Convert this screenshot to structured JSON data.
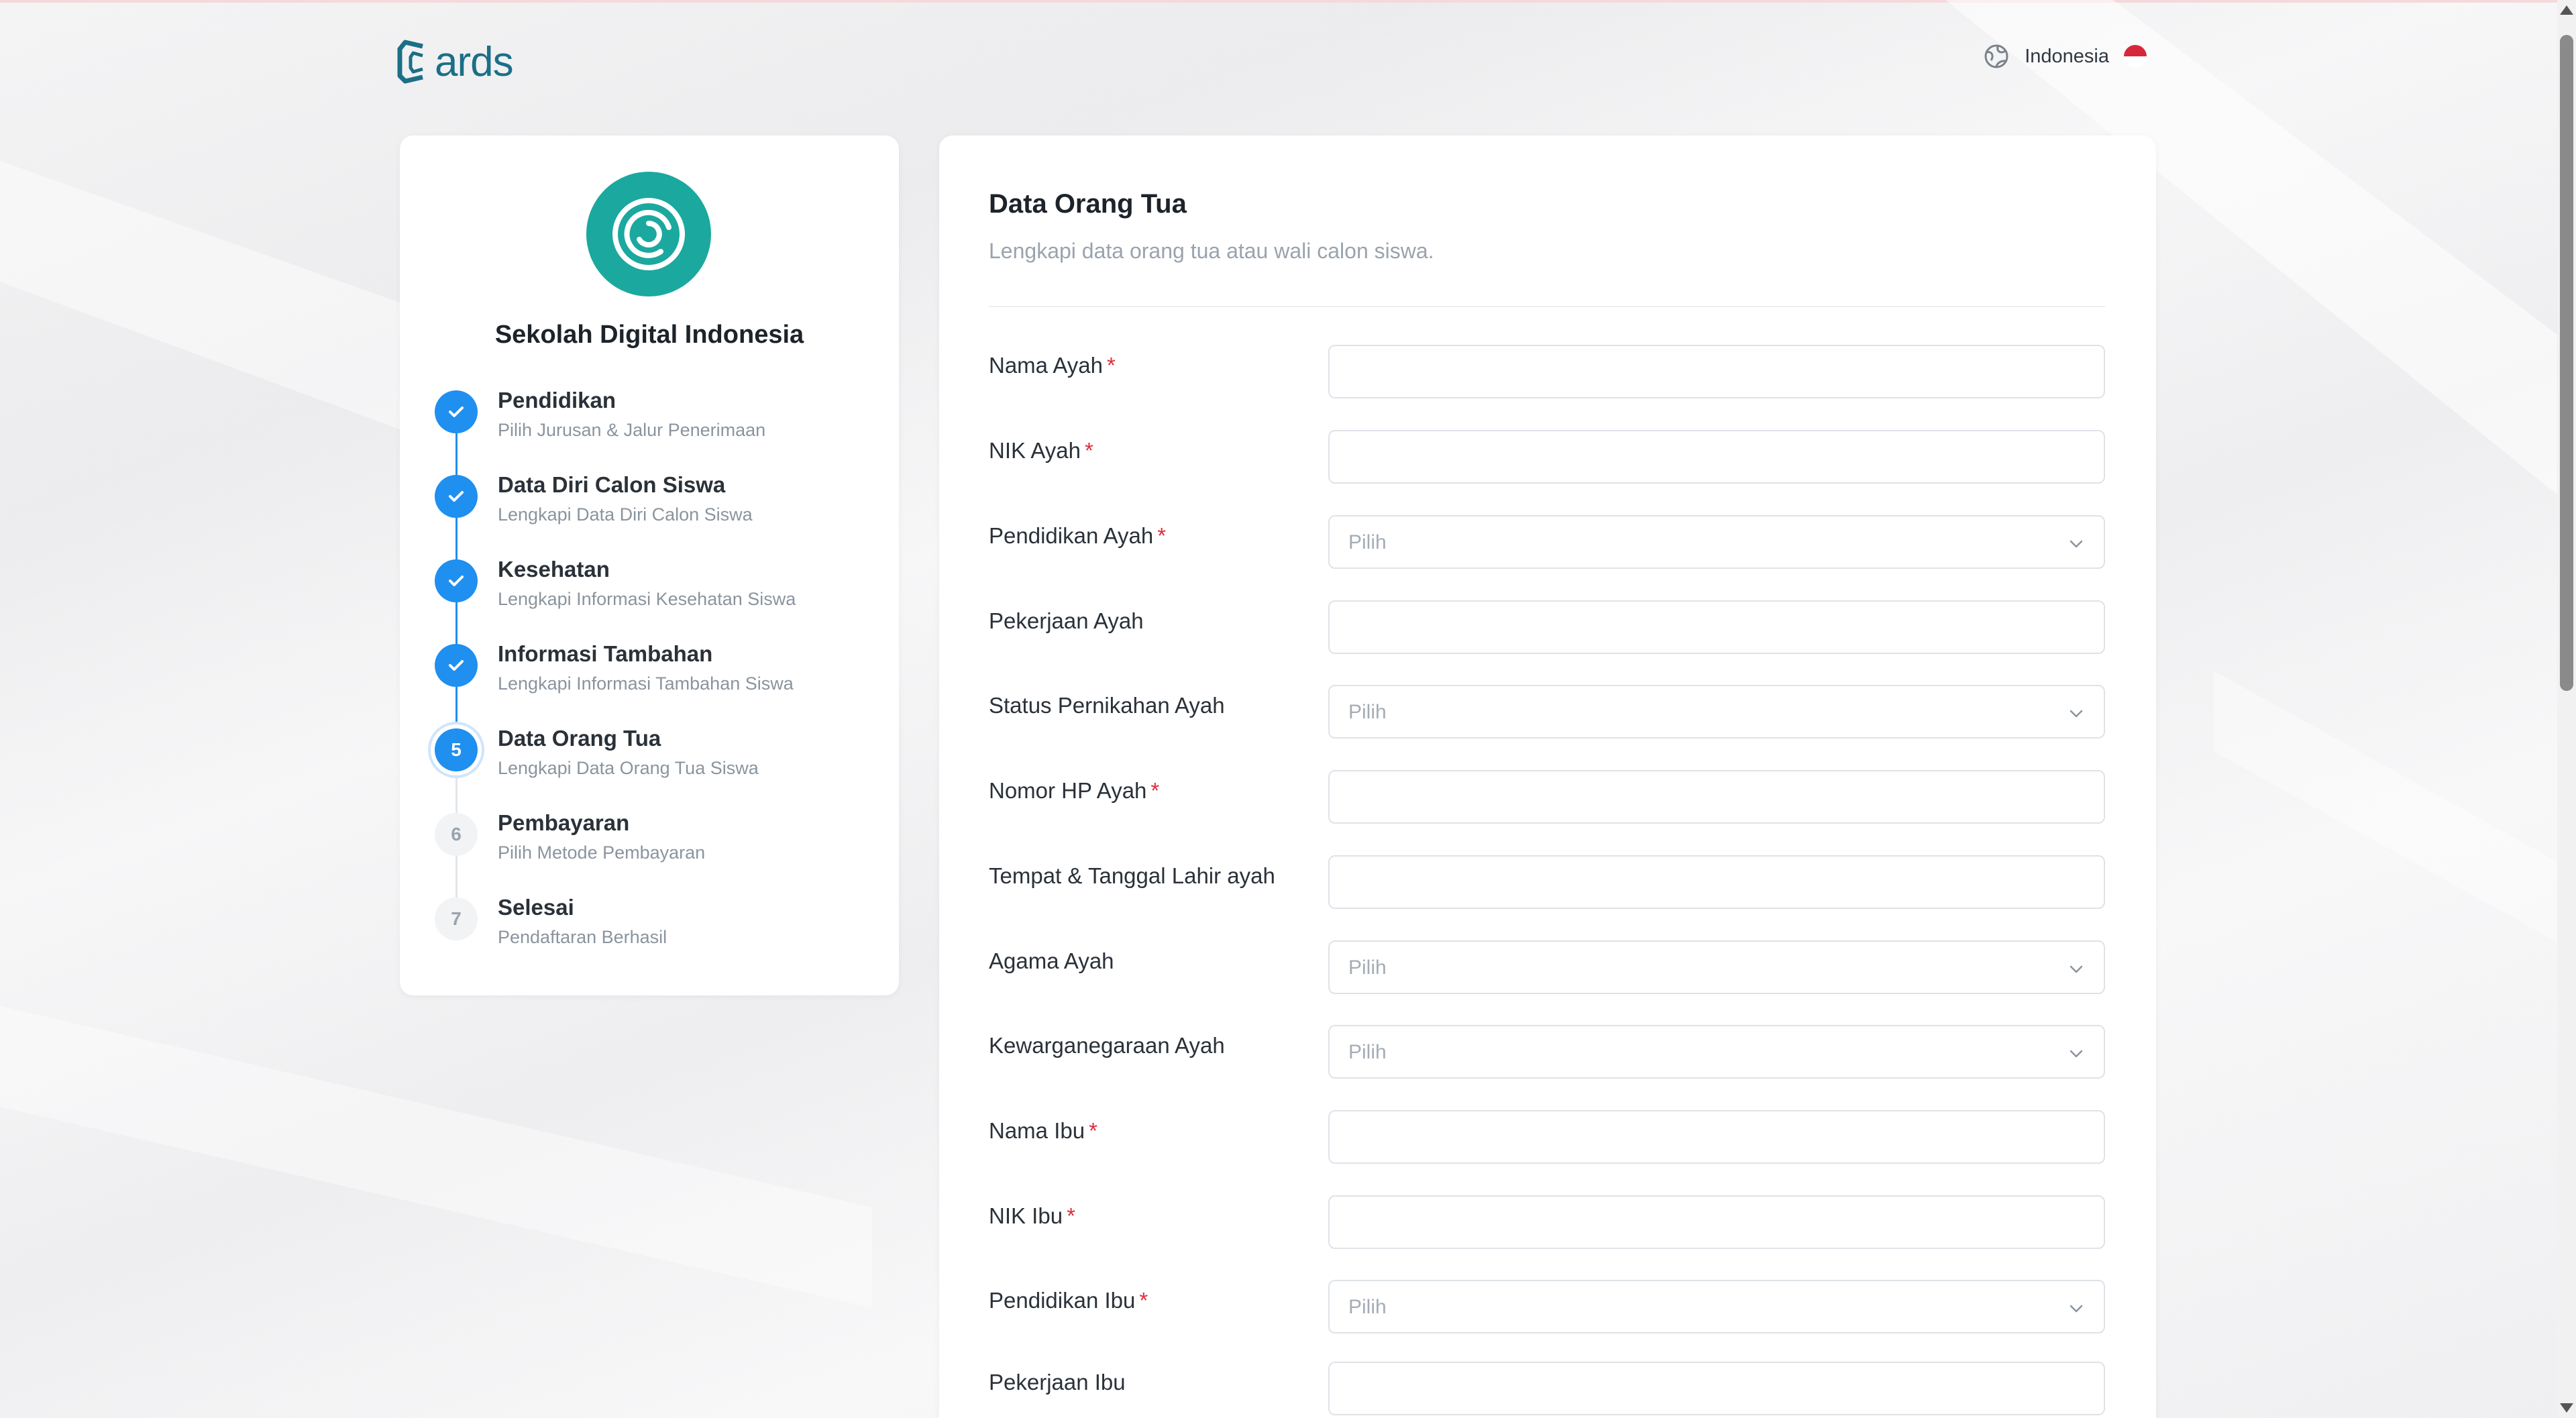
{
  "header": {
    "logo_text": "ards",
    "language": "Indonesia"
  },
  "colors": {
    "accent": "#1f8ff0",
    "school_logo": "#1ba89f",
    "required": "#e02c3c",
    "brand": "#1b6f86"
  },
  "sidebar": {
    "school_name": "Sekolah Digital Indonesia",
    "steps": [
      {
        "number": "1",
        "title": "Pendidikan",
        "subtitle": "Pilih Jurusan & Jalur Penerimaan",
        "status": "done"
      },
      {
        "number": "2",
        "title": "Data Diri Calon Siswa",
        "subtitle": "Lengkapi Data Diri Calon Siswa",
        "status": "done"
      },
      {
        "number": "3",
        "title": "Kesehatan",
        "subtitle": "Lengkapi Informasi Kesehatan Siswa",
        "status": "done"
      },
      {
        "number": "4",
        "title": "Informasi Tambahan",
        "subtitle": "Lengkapi Informasi Tambahan Siswa",
        "status": "done"
      },
      {
        "number": "5",
        "title": "Data Orang Tua",
        "subtitle": "Lengkapi Data Orang Tua Siswa",
        "status": "active"
      },
      {
        "number": "6",
        "title": "Pembayaran",
        "subtitle": "Pilih Metode Pembayaran",
        "status": "pending"
      },
      {
        "number": "7",
        "title": "Selesai",
        "subtitle": "Pendaftaran Berhasil",
        "status": "pending"
      }
    ]
  },
  "form": {
    "title": "Data Orang Tua",
    "subtitle": "Lengkapi data orang tua atau wali calon siswa.",
    "required_mark": "*",
    "fields": [
      {
        "label": "Nama Ayah",
        "required": true,
        "type": "text",
        "value": ""
      },
      {
        "label": "NIK Ayah",
        "required": true,
        "type": "text",
        "value": ""
      },
      {
        "label": "Pendidikan Ayah",
        "required": true,
        "type": "select",
        "placeholder": "Pilih"
      },
      {
        "label": "Pekerjaan Ayah",
        "required": false,
        "type": "text",
        "value": ""
      },
      {
        "label": "Status Pernikahan Ayah",
        "required": false,
        "type": "select",
        "placeholder": "Pilih"
      },
      {
        "label": "Nomor HP Ayah",
        "required": true,
        "type": "text",
        "value": ""
      },
      {
        "label": "Tempat & Tanggal Lahir ayah",
        "required": false,
        "type": "text",
        "value": ""
      },
      {
        "label": "Agama Ayah",
        "required": false,
        "type": "select",
        "placeholder": "Pilih"
      },
      {
        "label": "Kewarganegaraan Ayah",
        "required": false,
        "type": "select",
        "placeholder": "Pilih"
      },
      {
        "label": "Nama Ibu",
        "required": true,
        "type": "text",
        "value": ""
      },
      {
        "label": "NIK Ibu",
        "required": true,
        "type": "text",
        "value": ""
      },
      {
        "label": "Pendidikan Ibu",
        "required": true,
        "type": "select",
        "placeholder": "Pilih"
      },
      {
        "label": "Pekerjaan Ibu",
        "required": false,
        "type": "text",
        "value": ""
      }
    ]
  }
}
